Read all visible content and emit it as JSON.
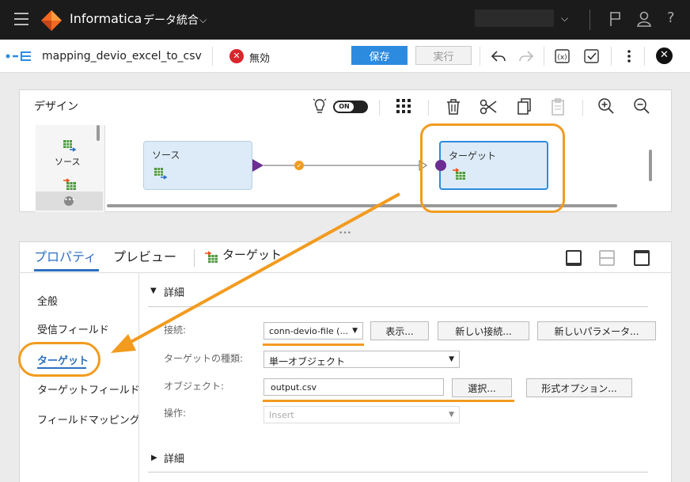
{
  "topbar": {
    "brand": "Informatica",
    "app_name": "データ統合",
    "help": "?"
  },
  "toolbar": {
    "mapping_name": "mapping_devio_excel_to_csv",
    "status": "無効",
    "save_label": "保存",
    "run_label": "実行"
  },
  "design": {
    "title": "デザイン",
    "toggle_label": "ON",
    "palette_source_label": "ソース",
    "source_node_label": "ソース",
    "target_node_label": "ターゲット"
  },
  "properties": {
    "tabs": [
      {
        "label": "プロパティ"
      },
      {
        "label": "プレビュー"
      },
      {
        "label": "ターゲット"
      }
    ],
    "sidebar": [
      {
        "label": "全般"
      },
      {
        "label": "受信フィールド"
      },
      {
        "label": "ターゲット"
      },
      {
        "label": "ターゲットフィールド"
      },
      {
        "label": "フィールドマッピング"
      }
    ],
    "details_header": "詳細",
    "details_footer": "詳細",
    "connection_label": "接続:",
    "connection_value": "conn-devio-file (...",
    "view_button": "表示...",
    "new_connection_button": "新しい接続...",
    "new_parameter_button": "新しいパラメータ...",
    "target_type_label": "ターゲットの種類:",
    "target_type_value": "単一オブジェクト",
    "object_label": "オブジェクト:",
    "object_value": "output.csv",
    "select_button": "選択...",
    "format_options_button": "形式オプション...",
    "operation_label": "操作:",
    "operation_value": "Insert"
  },
  "colors": {
    "accent": "#2d8bdf",
    "annotation": "#f29b1f",
    "error": "#d9262c"
  }
}
